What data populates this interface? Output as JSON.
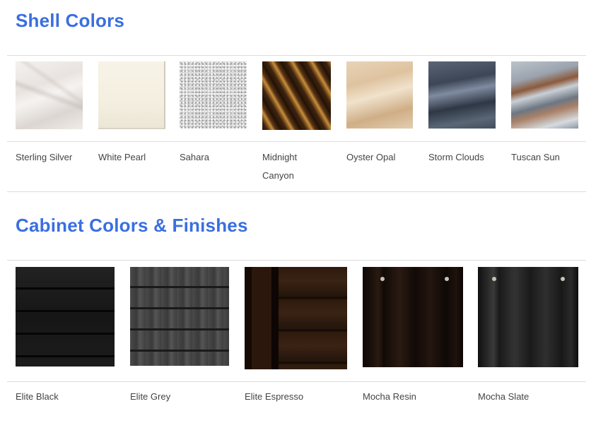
{
  "shell": {
    "title": "Shell Colors",
    "items": [
      {
        "label": "Sterling Silver"
      },
      {
        "label": "White Pearl"
      },
      {
        "label": "Sahara"
      },
      {
        "label": "Midnight Canyon"
      },
      {
        "label": "Oyster Opal"
      },
      {
        "label": "Storm Clouds"
      },
      {
        "label": "Tuscan Sun"
      }
    ]
  },
  "cabinet": {
    "title": "Cabinet Colors & Finishes",
    "items": [
      {
        "label": "Elite Black"
      },
      {
        "label": "Elite Grey"
      },
      {
        "label": "Elite Espresso"
      },
      {
        "label": "Mocha Resin"
      },
      {
        "label": "Mocha Slate"
      }
    ]
  },
  "colors": {
    "heading": "#3a6fe0",
    "rule": "#dcdcdc",
    "text": "#444444"
  }
}
